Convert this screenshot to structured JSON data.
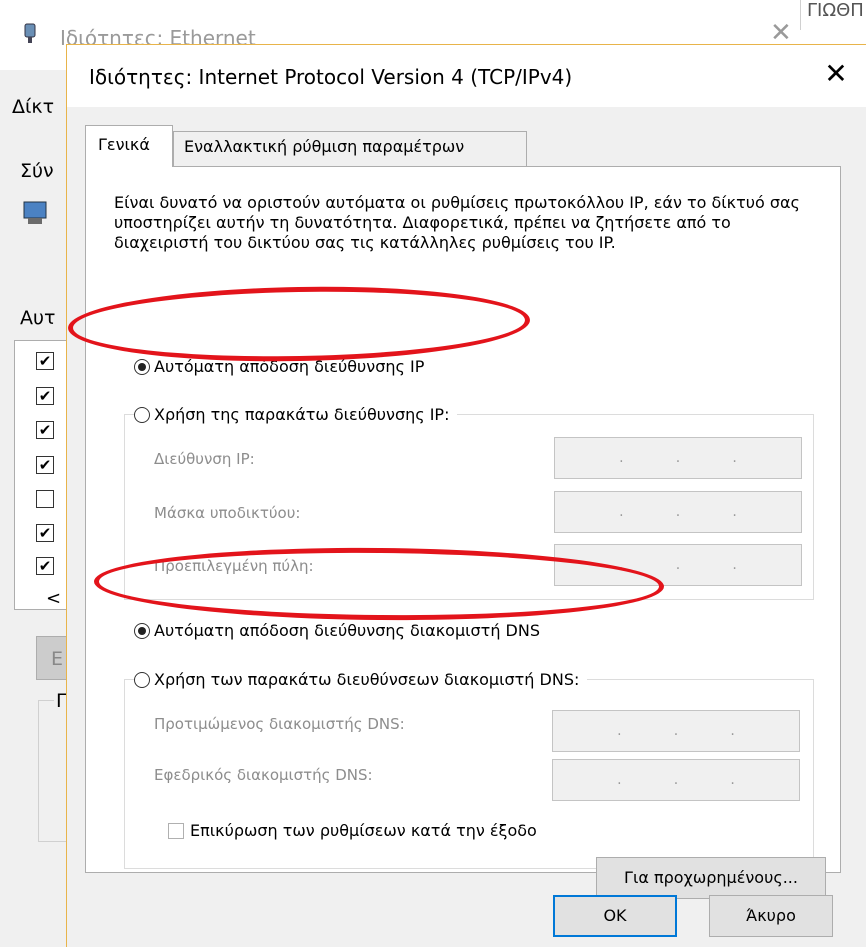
{
  "colors": {
    "highlight_ellipse": "#e3141b",
    "default_button_border": "#0078d7",
    "dialog_border": "#e8b44a"
  },
  "background_window": {
    "title": "Ιδιότητες: Ethernet",
    "title_icon": "network-adapter-icon",
    "corner_text": "ΓΙΩΘΠ",
    "tab_label": "Δίκτ",
    "label_connect": "Σύν",
    "label_items": "Αυτ",
    "list_checks": [
      true,
      true,
      true,
      true,
      false,
      true,
      true
    ],
    "scroll_left": "<",
    "button_partial": "Ε",
    "group_partial": "Π"
  },
  "dialog": {
    "title": "Ιδιότητες: Internet Protocol Version 4 (TCP/IPv4)",
    "close_glyph": "✕",
    "tabs": [
      {
        "label": "Γενικά",
        "active": true
      },
      {
        "label": "Εναλλακτική ρύθμιση παραμέτρων",
        "active": false
      }
    ],
    "description": "Είναι δυνατό να οριστούν αυτόματα οι ρυθμίσεις πρωτοκόλλου IP, εάν το δίκτυό σας υποστηρίζει αυτήν τη δυνατότητα. Διαφορετικά, πρέπει να ζητήσετε από το διαχειριστή του δικτύου σας τις κατάλληλες ρυθμίσεις του IP.",
    "ip": {
      "auto_label": "Αυτόματη απόδοση διεύθυνσης IP",
      "auto_selected": true,
      "manual_label": "Χρήση της παρακάτω διεύθυνσης IP:",
      "fields": [
        {
          "label": "Διεύθυνση IP:",
          "value": " .  .  ."
        },
        {
          "label": "Μάσκα υποδικτύου:",
          "value": " .  .  ."
        },
        {
          "label": "Προεπιλεγμένη πύλη:",
          "value": " .  .  ."
        }
      ]
    },
    "dns": {
      "auto_label": "Αυτόματη απόδοση διεύθυνσης διακομιστή DNS",
      "auto_selected": true,
      "manual_label": "Χρήση των παρακάτω διευθύνσεων διακομιστή DNS:",
      "fields": [
        {
          "label": "Προτιμώμενος διακομιστής DNS:",
          "value": " .  .  ."
        },
        {
          "label": "Εφεδρικός διακομιστής DNS:",
          "value": " .  .  ."
        }
      ]
    },
    "validate_label": "Επικύρωση των ρυθμίσεων κατά την έξοδο",
    "validate_checked": false,
    "advanced_label": "Για προχωρημένους...",
    "ok_label": "OK",
    "cancel_label": "Άκυρο"
  }
}
